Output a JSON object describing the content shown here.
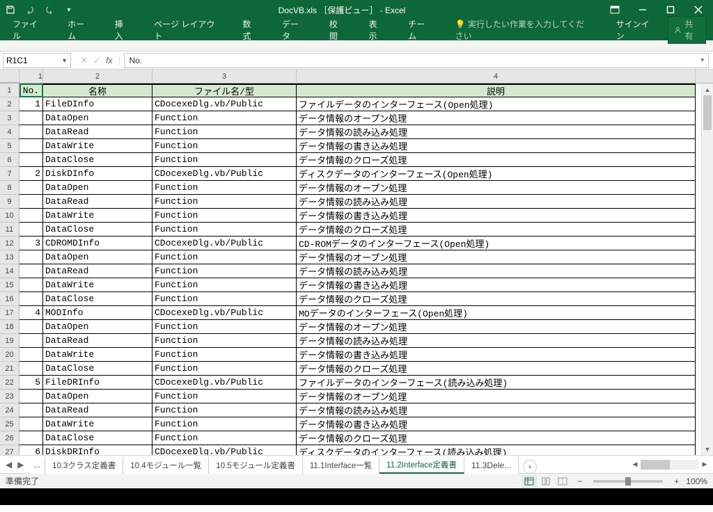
{
  "title": "DocVB.xls ［保護ビュー］ - Excel",
  "ribbon": {
    "file": "ファイル",
    "home": "ホーム",
    "insert": "挿入",
    "pagelayout": "ページ レイアウト",
    "formulas": "数式",
    "data": "データ",
    "review": "校閲",
    "view": "表示",
    "team": "チーム",
    "tell": "実行したい作業を入力してください",
    "signin": "サインイン",
    "share": "共有"
  },
  "namebox": "R1C1",
  "fx_label": "fx",
  "formula": "No.",
  "cols": [
    "1",
    "2",
    "3",
    "4"
  ],
  "headers": {
    "no": "No.",
    "name": "名称",
    "file": "ファイル名/型",
    "desc": "説明"
  },
  "rows": [
    {
      "r": "1",
      "no": "",
      "name": "",
      "file": "",
      "desc": "",
      "hdr": true
    },
    {
      "r": "2",
      "no": "1",
      "name": "FileDInfo",
      "file": "CDocexeDlg.vb/Public",
      "desc": "ファイルデータのインターフェース(Open処理)"
    },
    {
      "r": "3",
      "no": "",
      "name": "DataOpen",
      "file": "Function",
      "desc": "データ情報のオープン処理"
    },
    {
      "r": "4",
      "no": "",
      "name": "DataRead",
      "file": "Function",
      "desc": "データ情報の読み込み処理"
    },
    {
      "r": "5",
      "no": "",
      "name": "DataWrite",
      "file": "Function",
      "desc": "データ情報の書き込み処理"
    },
    {
      "r": "6",
      "no": "",
      "name": "DataClose",
      "file": "Function",
      "desc": "データ情報のクローズ処理"
    },
    {
      "r": "7",
      "no": "2",
      "name": "DiskDInfo",
      "file": "CDocexeDlg.vb/Public",
      "desc": "ディスクデータのインターフェース(Open処理)"
    },
    {
      "r": "8",
      "no": "",
      "name": "DataOpen",
      "file": "Function",
      "desc": "データ情報のオープン処理"
    },
    {
      "r": "9",
      "no": "",
      "name": "DataRead",
      "file": "Function",
      "desc": "データ情報の読み込み処理"
    },
    {
      "r": "10",
      "no": "",
      "name": "DataWrite",
      "file": "Function",
      "desc": "データ情報の書き込み処理"
    },
    {
      "r": "11",
      "no": "",
      "name": "DataClose",
      "file": "Function",
      "desc": "データ情報のクローズ処理"
    },
    {
      "r": "12",
      "no": "3",
      "name": "CDROMDInfo",
      "file": "CDocexeDlg.vb/Public",
      "desc": "CD-ROMデータのインターフェース(Open処理)"
    },
    {
      "r": "13",
      "no": "",
      "name": "DataOpen",
      "file": "Function",
      "desc": "データ情報のオープン処理"
    },
    {
      "r": "14",
      "no": "",
      "name": "DataRead",
      "file": "Function",
      "desc": "データ情報の読み込み処理"
    },
    {
      "r": "15",
      "no": "",
      "name": "DataWrite",
      "file": "Function",
      "desc": "データ情報の書き込み処理"
    },
    {
      "r": "16",
      "no": "",
      "name": "DataClose",
      "file": "Function",
      "desc": "データ情報のクローズ処理"
    },
    {
      "r": "17",
      "no": "4",
      "name": "MODInfo",
      "file": "CDocexeDlg.vb/Public",
      "desc": "MOデータのインターフェース(Open処理)"
    },
    {
      "r": "18",
      "no": "",
      "name": "DataOpen",
      "file": "Function",
      "desc": "データ情報のオープン処理"
    },
    {
      "r": "19",
      "no": "",
      "name": "DataRead",
      "file": "Function",
      "desc": "データ情報の読み込み処理"
    },
    {
      "r": "20",
      "no": "",
      "name": "DataWrite",
      "file": "Function",
      "desc": "データ情報の書き込み処理"
    },
    {
      "r": "21",
      "no": "",
      "name": "DataClose",
      "file": "Function",
      "desc": "データ情報のクローズ処理"
    },
    {
      "r": "22",
      "no": "5",
      "name": "FileDRInfo",
      "file": "CDocexeDlg.vb/Public",
      "desc": "ファイルデータのインターフェース(読み込み処理)"
    },
    {
      "r": "23",
      "no": "",
      "name": "DataOpen",
      "file": "Function",
      "desc": "データ情報のオープン処理"
    },
    {
      "r": "24",
      "no": "",
      "name": "DataRead",
      "file": "Function",
      "desc": "データ情報の読み込み処理"
    },
    {
      "r": "25",
      "no": "",
      "name": "DataWrite",
      "file": "Function",
      "desc": "データ情報の書き込み処理"
    },
    {
      "r": "26",
      "no": "",
      "name": "DataClose",
      "file": "Function",
      "desc": "データ情報のクローズ処理"
    },
    {
      "r": "27",
      "no": "6",
      "name": "DiskDRInfo",
      "file": "CDocexeDlg.vb/Public",
      "desc": "ディスクデータのインターフェース(読み込み処理)"
    }
  ],
  "tabs": {
    "ellipsis": "...",
    "t1": "10.3クラス定義書",
    "t2": "10.4モジュール一覧",
    "t3": "10.5モジュール定義書",
    "t4": "11.1Interface一覧",
    "t5": "11.2Interface定義書",
    "t6": "11.3Dele"
  },
  "status": {
    "ready": "準備完了",
    "zoom": "100%",
    "minus": "−",
    "plus": "+"
  }
}
